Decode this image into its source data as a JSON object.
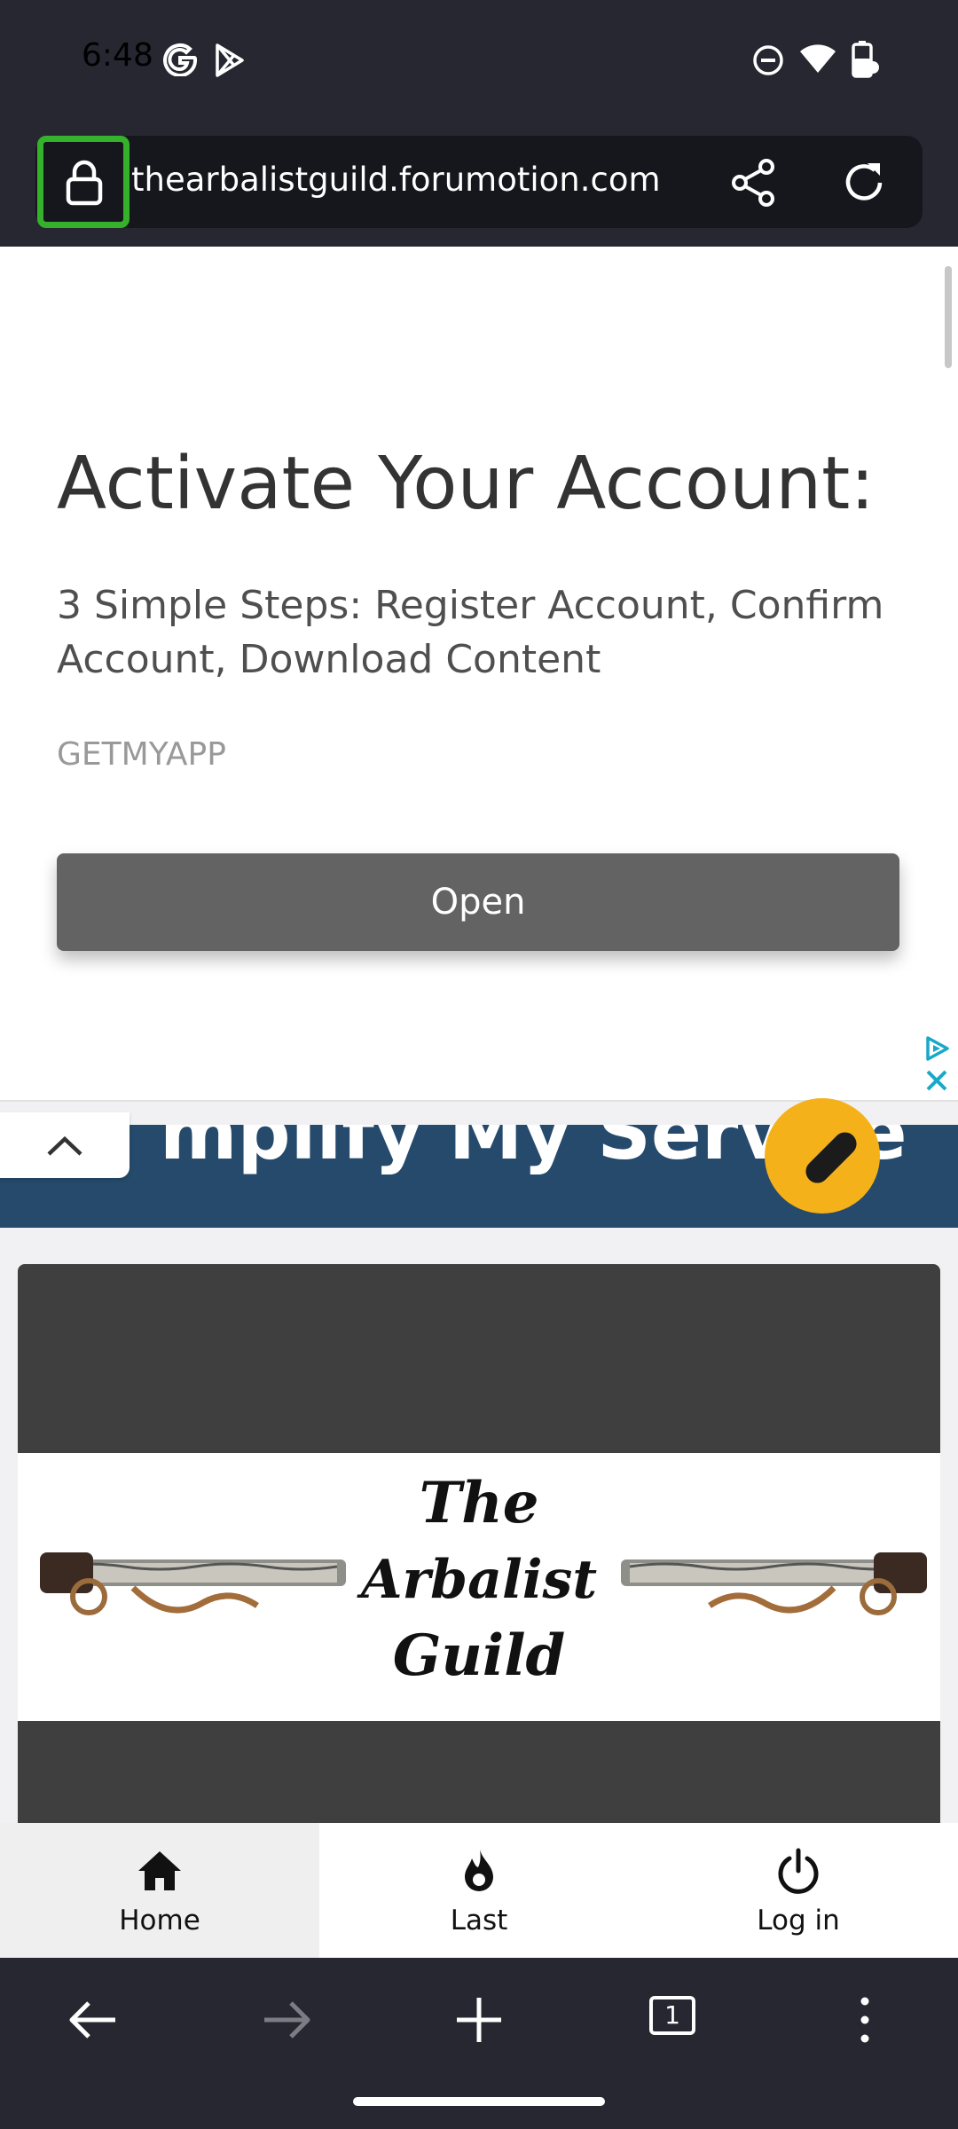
{
  "status_bar": {
    "time": "6:48"
  },
  "browser": {
    "url": "thearbalistguild.forumotion.com"
  },
  "ad": {
    "headline": "Activate Your Account:",
    "body": "3 Simple Steps: Register Account, Confirm Account, Download Content",
    "advertiser": "GETMYAPP",
    "cta_label": "Open",
    "accent_color": "#636363"
  },
  "banner": {
    "text": "mplify My Service",
    "color": "#254a6b"
  },
  "forum": {
    "logo_words": [
      "The",
      "Arbalist",
      "Guild"
    ]
  },
  "forum_nav": {
    "items": [
      {
        "label": "Home",
        "icon": "home-icon"
      },
      {
        "label": "Last",
        "icon": "flame-icon"
      },
      {
        "label": "Log in",
        "icon": "power-icon"
      }
    ]
  },
  "browser_bottom": {
    "tab_count": "1"
  }
}
